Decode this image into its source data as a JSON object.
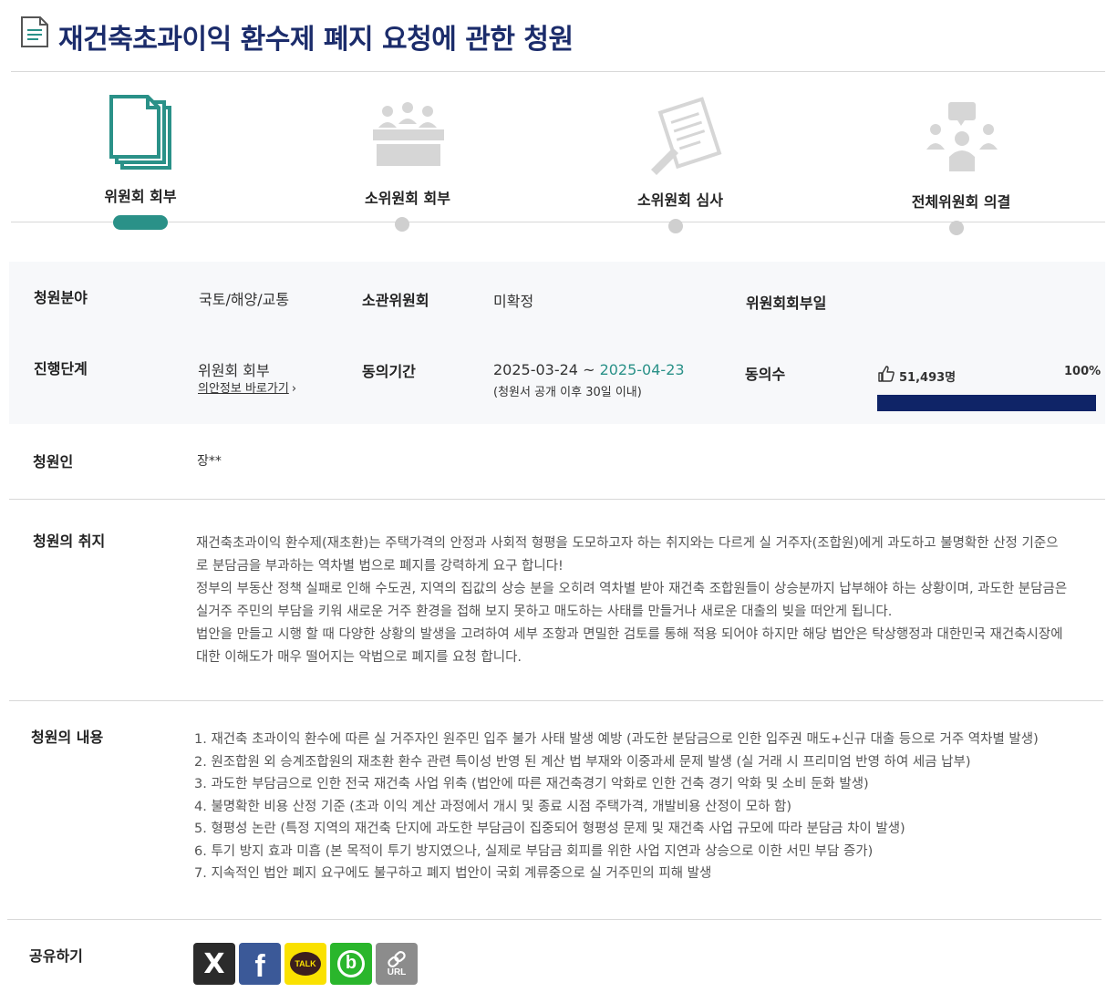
{
  "title": "재건축초과이익 환수제 폐지 요청에 관한 청원",
  "steps": [
    {
      "label": "위원회 회부",
      "active": true
    },
    {
      "label": "소위원회 회부",
      "active": false
    },
    {
      "label": "소위원회 심사",
      "active": false
    },
    {
      "label": "전체위원회 의결",
      "active": false
    }
  ],
  "info": {
    "field_label": "청원분야",
    "field_value": "국토/해양/교통",
    "committee_label": "소관위원회",
    "committee_value": "미확정",
    "referral_date_label": "위원회회부일",
    "stage_label": "진행단계",
    "stage_value": "위원회 회부",
    "bill_link": "의안정보 바로가기",
    "agree_period_label": "동의기간",
    "agree_start": "2025-03-24",
    "agree_sep": " ~ ",
    "agree_end": "2025-04-23",
    "agree_note": "(청원서 공개 이후 30일 이내)",
    "agree_count_label": "동의수",
    "agree_count": "51,493명",
    "agree_percent": "100%",
    "agree_progress": 1.0
  },
  "petitioner": {
    "label": "청원인",
    "value": "장**"
  },
  "purpose": {
    "label": "청원의 취지",
    "lines": [
      "재건축초과이익 환수제(재초환)는 주택가격의 안정과 사회적 형평을 도모하고자 하는 취지와는 다르게 실 거주자(조합원)에게 과도하고 불명확한 산정 기준으",
      "로 분담금을 부과하는 역차별 법으로 폐지를 강력하게 요구 합니다!",
      "정부의 부동산 정책 실패로 인해 수도권, 지역의 집값의 상승 분을 오히려 역차별 받아 재건축 조합원들이 상승분까지 납부해야 하는 상황이며, 과도한 분담금은",
      "실거주 주민의 부담을 키워 새로운 거주 환경을 접해 보지 못하고 매도하는 사태를 만들거나 새로운 대출의 빚을 떠안게 됩니다.",
      "법안을 만들고 시행 할 때 다양한 상황의 발생을 고려하여 세부 조항과 면밀한 검토를 통해 적용 되어야 하지만 해당 법안은 탁상행정과 대한민국 재건축시장에",
      "대한 이해도가 매우 떨어지는 악법으로 폐지를 요청 합니다."
    ]
  },
  "content": {
    "label": "청원의 내용",
    "items": [
      "1. 재건축 초과이익 환수에 따른 실 거주자인 원주민 입주 불가 사태 발생 예방 (과도한 분담금으로 인한 입주권 매도+신규 대출 등으로 거주 역차별 발생)",
      "2. 원조합원 외 승계조합원의 재초환 환수 관련 특이성 반영 된 계산 법 부재와 이중과세 문제 발생 (실 거래 시 프리미엄 반영 하여 세금 납부)",
      "3. 과도한 부담금으로 인한 전국 재건축 사업 위축 (법안에 따른 재건축경기 악화로 인한 건축 경기 악화 및 소비 둔화 발생)",
      "4. 불명확한 비용 산정 기준 (초과 이익 계산 과정에서 개시 및 종료 시점 주택가격, 개발비용 산정이 모하 함)",
      "5. 형평성 논란 (특정 지역의 재건축 단지에 과도한 부담금이 집중되어 형평성 문제 및 재건축 사업 규모에 따라 분담금 차이 발생)",
      "6. 투기 방지 효과 미흡 (본 목적이 투기 방지였으나, 실제로 부담금 회피를 위한 사업 지연과 상승으로 이한 서민 부담 증가)",
      "7. 지속적인 법안 폐지 요구에도 불구하고 폐지 법안이 국회 계류중으로 실 거주민의 피해 발생"
    ]
  },
  "share": {
    "label": "공유하기",
    "buttons": [
      {
        "name": "x",
        "icon": "x-icon",
        "color": "#2b2b2b",
        "text": "X"
      },
      {
        "name": "facebook",
        "icon": "facebook-icon",
        "color": "#3b5998",
        "text": "f"
      },
      {
        "name": "kakaotalk",
        "icon": "kakaotalk-icon",
        "color": "#fae100",
        "text": "TALK"
      },
      {
        "name": "band",
        "icon": "band-icon",
        "color": "#2ab62c",
        "text": "b"
      },
      {
        "name": "url",
        "icon": "link-icon",
        "color": "#8c8c8c",
        "text": "URL"
      }
    ]
  },
  "colors": {
    "title": "#1b2c6b",
    "accent": "#2a9188",
    "progress": "#0f2467",
    "inactive_step": "#cfcfcf"
  }
}
